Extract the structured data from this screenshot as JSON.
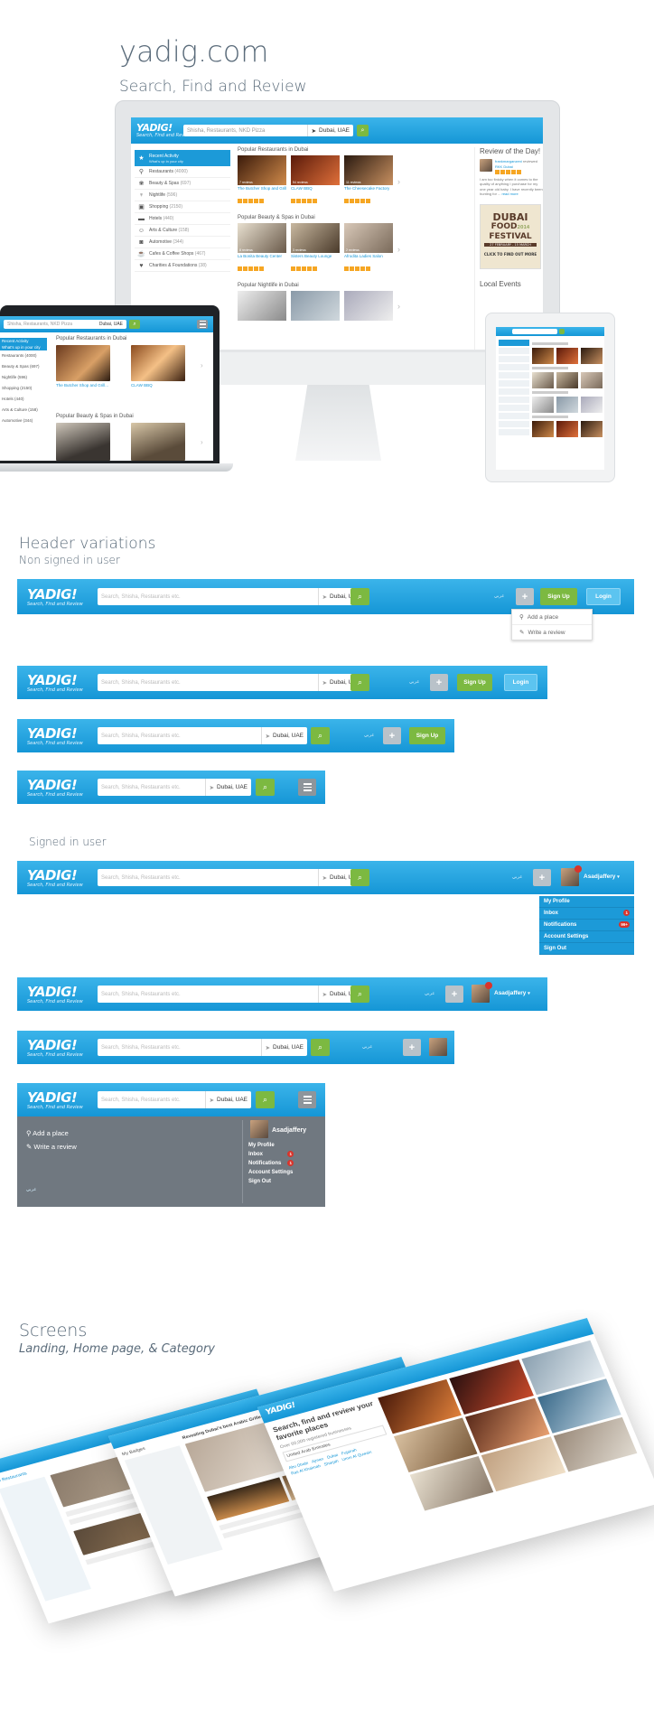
{
  "hero": {
    "title": "yadig.com",
    "subtitle": "Search, Find and Review"
  },
  "brand": {
    "logo": "YADIG!",
    "tagline": "Search, Find and Review",
    "blue": "#1596d6",
    "green": "#7cb941"
  },
  "desktop": {
    "search_placeholder": "Shisha, Restaurants, NKD Pizza",
    "location": "Dubai, UAE",
    "sidebar": [
      {
        "label": "Recent Activity",
        "sub": "What's up in your city",
        "icon": "star-icon"
      },
      {
        "label": "Restaurants",
        "count": "(4000)",
        "icon": "fork-icon"
      },
      {
        "label": "Beauty & Spas",
        "count": "(697)",
        "icon": "spa-icon"
      },
      {
        "label": "Nightlife",
        "count": "(596)",
        "icon": "glass-icon"
      },
      {
        "label": "Shopping",
        "count": "(2150)",
        "icon": "bag-icon"
      },
      {
        "label": "Hotels",
        "count": "(440)",
        "icon": "bed-icon"
      },
      {
        "label": "Arts & Culture",
        "count": "(158)",
        "icon": "mask-icon"
      },
      {
        "label": "Automotive",
        "count": "(344)",
        "icon": "car-icon"
      },
      {
        "label": "Cafes & Coffee Shops",
        "count": "(467)",
        "icon": "cup-icon"
      },
      {
        "label": "Charities & Foundations",
        "count": "(38)",
        "icon": "heart-icon"
      }
    ],
    "sections": [
      {
        "title": "Popular Restaurants in Dubai",
        "items": [
          {
            "name": "The Butcher Shop and Grill...",
            "reviews": "7 reviews"
          },
          {
            "name": "CLAW BBQ",
            "reviews": "54 reviews"
          },
          {
            "name": "The Cheesecake Factory",
            "reviews": "11 reviews"
          }
        ]
      },
      {
        "title": "Popular Beauty & Spas in Dubai",
        "items": [
          {
            "name": "La Bonita Beauty Center",
            "reviews": "8 reviews"
          },
          {
            "name": "Sisters Beauty Lounge",
            "reviews": "3 reviews"
          },
          {
            "name": "Afrodita Ladies Salon",
            "reviews": "2 reviews"
          }
        ]
      },
      {
        "title": "Popular Nightlife in Dubai",
        "items": []
      }
    ],
    "right": {
      "review_title": "Review of the Day!",
      "reviewer": "frankmarganzeni",
      "reviewed": "reviewed",
      "place": "RKK Dubai",
      "text": "I am too finicky when it comes to the quality of anything I purchase for my one year old baby. I have recently been hunting for ...",
      "read_more": "read more",
      "ad_title1": "DUBAI",
      "ad_title2": "FOOD",
      "ad_title3": "FESTIVAL",
      "ad_year": "2014",
      "ad_dates": "27 FEBRUARY - 15 MARCH",
      "ad_cta": "CLICK TO FIND OUT MORE",
      "local_events": "Local Events"
    }
  },
  "laptop": {
    "search_placeholder": "Shisha, Restaurants, NKD Pizza",
    "location": "Dubai, UAE",
    "sidebar": [
      "Recent Activity",
      "What's up in your city",
      "Restaurants (4000)",
      "Beauty & Spas (697)",
      "Nightlife (596)",
      "Shopping (2150)",
      "Hotels (440)",
      "Arts & Culture (158)",
      "Automotive (344)"
    ],
    "section1": "Popular Restaurants in Dubai",
    "item1": "The Butcher Shop and Grill...",
    "item2": "CLAW BBQ",
    "section2": "Popular Beauty & Spas in Dubai"
  },
  "header_variations": {
    "title": "Header variations",
    "non_signed": "Non signed in user",
    "signed": "Signed in user",
    "search_placeholder": "Search, Shisha, Restaurants etc.",
    "location": "Dubai, UAE",
    "arabic": "عربي",
    "sign_up": "Sign Up",
    "login": "Login",
    "add_place": "Add a place",
    "write_review": "Write a review",
    "username": "Asadjaffery",
    "user_menu": [
      {
        "label": "My Profile",
        "badge": ""
      },
      {
        "label": "Inbox",
        "badge": "1"
      },
      {
        "label": "Notifications",
        "badge": "99+"
      },
      {
        "label": "Account Settings",
        "badge": ""
      },
      {
        "label": "Sign Out",
        "badge": ""
      }
    ],
    "mobile_menu": [
      {
        "label": "My Profile",
        "badge": ""
      },
      {
        "label": "Inbox",
        "badge": "1"
      },
      {
        "label": "Notifications",
        "badge": "1"
      },
      {
        "label": "Account Settings",
        "badge": ""
      },
      {
        "label": "Sign Out",
        "badge": ""
      }
    ]
  },
  "screens": {
    "title": "Screens",
    "subtitle": "Landing, Home page, & Category",
    "landing_headline": "Search, find and review your favorite places",
    "landing_sub": "Over 60,000 registered businesses",
    "landing_loc": "United Arab Emirates",
    "cities": [
      "Abu Dhabi",
      "Ajman",
      "Dubai",
      "Fujairah",
      "Ras Al Khaimah",
      "Sharjah",
      "Umm Al Quwain"
    ],
    "home_title": "Revealing Dubai's best Arabic Grilled Meat",
    "home_side": "My Badges",
    "cat_tab": "All Restaurants"
  }
}
